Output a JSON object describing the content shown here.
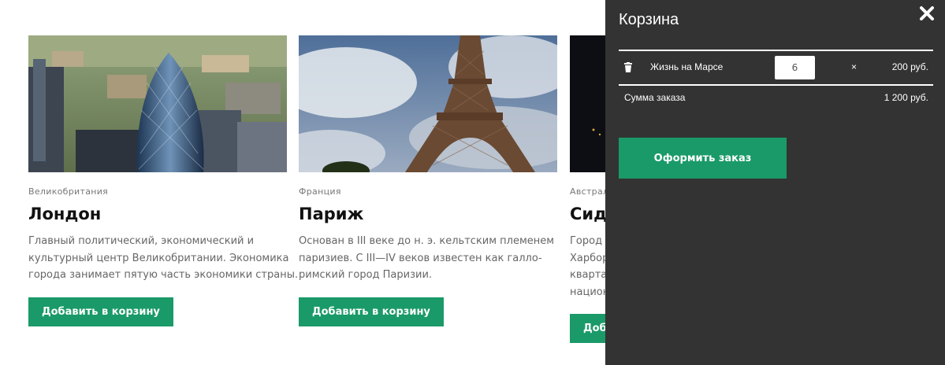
{
  "cards": [
    {
      "country": "Великобритания",
      "title": "Лондон",
      "desc_lines": [
        "Главный политический, экономический и",
        "культурный центр Великобритании. Экономика",
        "города занимает пятую часть экономики страны."
      ],
      "button_label": "Добавить в корзину"
    },
    {
      "country": "Франция",
      "title": "Париж",
      "desc_lines": [
        "Основан в III веке до н. э. кельтским племенем",
        "паризиев. С III—IV веков известен как галло-",
        "римский город Паризии."
      ],
      "button_label": "Добавить в корзину"
    },
    {
      "country": "Австрал",
      "title": "Сидн",
      "desc_lines": [
        "Город",
        "Харбор",
        "квартал",
        "национ"
      ],
      "button_label": "Добав"
    }
  ],
  "cart": {
    "title": "Корзина",
    "items": [
      {
        "name": "Жизнь на Марсе",
        "quantity": "6",
        "times": "×",
        "price": "200 руб."
      }
    ],
    "sum_label": "Сумма заказа",
    "sum_value": "1 200 руб.",
    "checkout_label": "Оформить заказ"
  },
  "colors": {
    "accent": "#1a9a68",
    "cart_bg": "#333333"
  },
  "icons": {
    "close": "close-icon",
    "trash": "trash-icon"
  }
}
